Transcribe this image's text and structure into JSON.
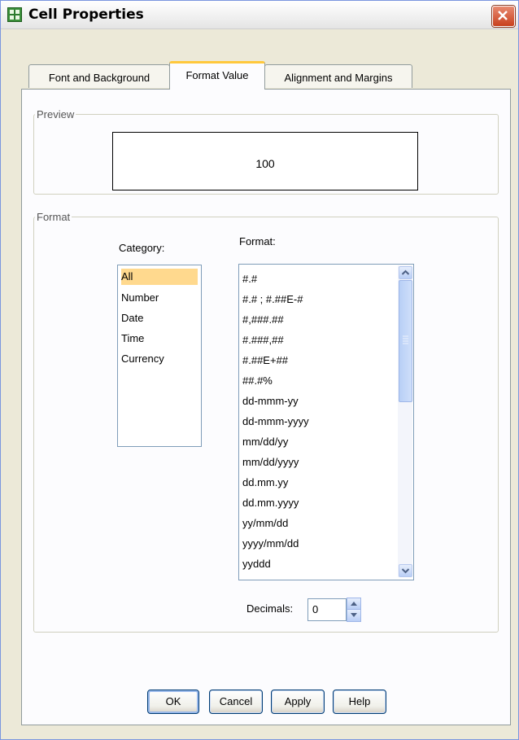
{
  "window": {
    "title": "Cell Properties"
  },
  "tabs": [
    {
      "label": "Font and Background"
    },
    {
      "label": "Format Value"
    },
    {
      "label": "Alignment and Margins"
    }
  ],
  "preview": {
    "legend": "Preview",
    "value": "100"
  },
  "format_group": {
    "legend": "Format",
    "category_label": "Category:",
    "format_label": "Format:",
    "categories": [
      "All",
      "Number",
      "Date",
      "Time",
      "Currency"
    ],
    "selected_category": "All",
    "formats": [
      "#.#",
      "#.# ; #.##E-#",
      "#,###.##",
      "#.###,##",
      "#.##E+##",
      "##.#%",
      "dd-mmm-yy",
      "dd-mmm-yyyy",
      "mm/dd/yy",
      "mm/dd/yyyy",
      "dd.mm.yy",
      "dd.mm.yyyy",
      "yy/mm/dd",
      "yyyy/mm/dd",
      "yyddd"
    ],
    "decimals_label": "Decimals:",
    "decimals_value": "0"
  },
  "buttons": {
    "ok": "OK",
    "cancel": "Cancel",
    "apply": "Apply",
    "help": "Help"
  },
  "colors": {
    "selection": "#ffd98e",
    "tab_highlight": "#ffc83c",
    "close_button": "#c8411e"
  },
  "icons": {
    "title": "grid-icon",
    "close": "close-icon"
  }
}
